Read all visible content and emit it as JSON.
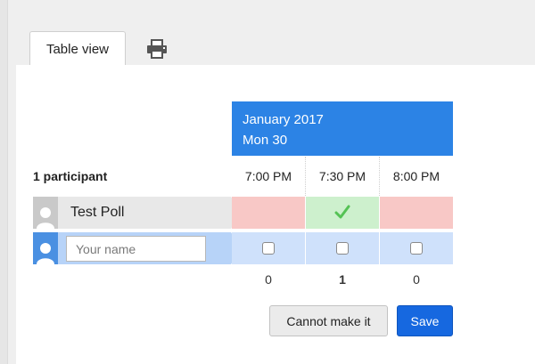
{
  "tabs": {
    "table_view_label": "Table view",
    "print_icon": "printer-icon"
  },
  "date_header": {
    "month_year": "January 2017",
    "day": "Mon 30"
  },
  "participants_label": "1 participant",
  "times": [
    "7:00 PM",
    "7:30 PM",
    "8:00 PM"
  ],
  "participants": [
    {
      "name": "Test Poll",
      "votes": [
        "no",
        "yes",
        "no"
      ]
    }
  ],
  "new_entry": {
    "placeholder": "Your name",
    "value": ""
  },
  "counts": [
    "0",
    "1",
    "0"
  ],
  "buttons": {
    "cannot_make_it": "Cannot make it",
    "save": "Save"
  },
  "colors": {
    "header_blue": "#2c83e5",
    "no_bg": "#f8c8c6",
    "yes_bg": "#cdf0cd",
    "yes_check": "#55c255",
    "new_row_bg": "#cfe1fb",
    "save_blue": "#1668e0"
  }
}
